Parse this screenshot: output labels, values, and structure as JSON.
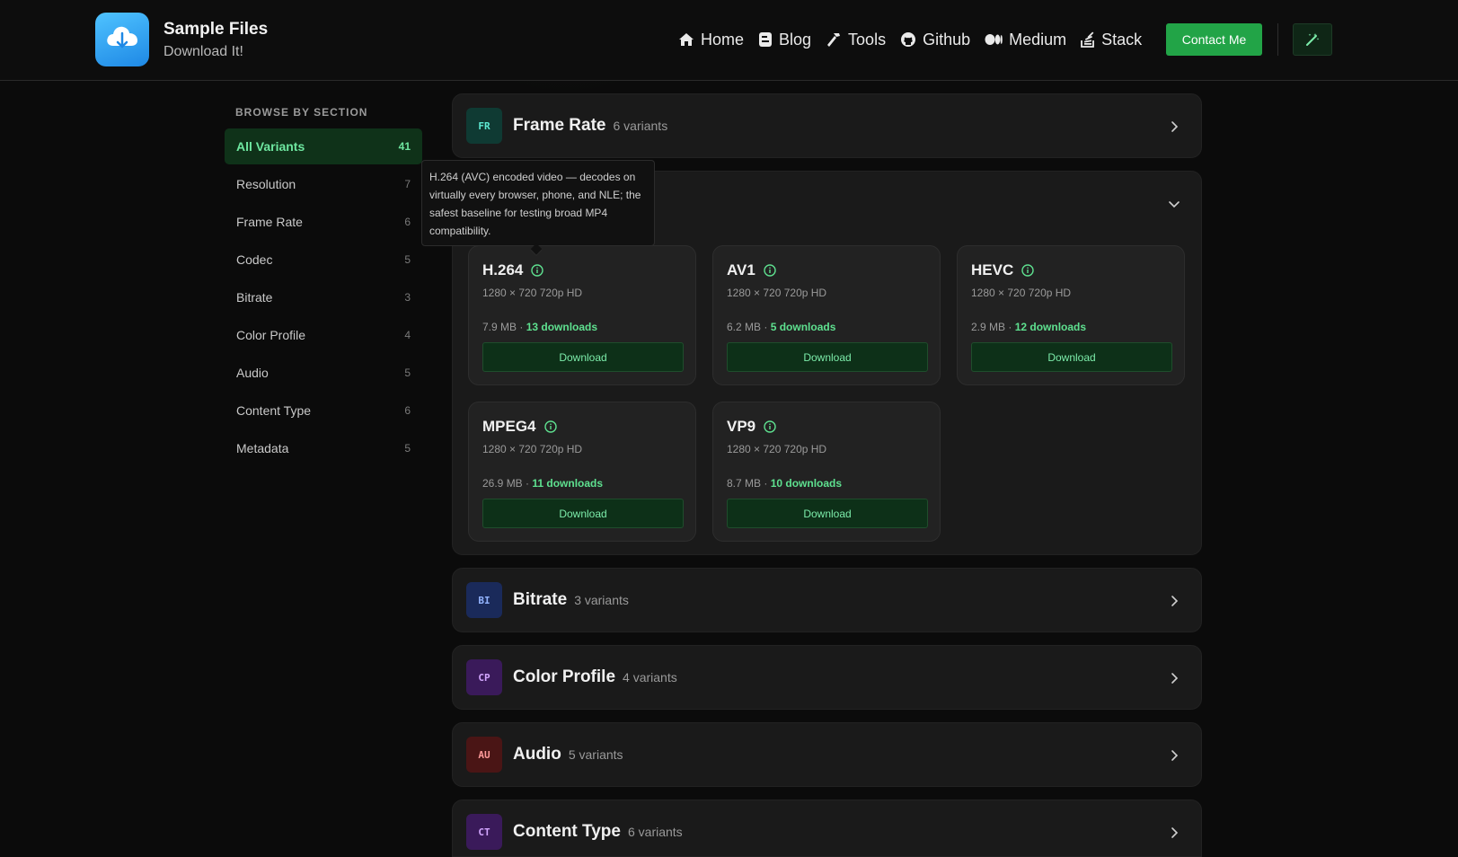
{
  "brand": {
    "title": "Sample Files",
    "subtitle": "Download It!"
  },
  "nav": [
    {
      "label": "Home",
      "icon": "home-icon"
    },
    {
      "label": "Blog",
      "icon": "blog-icon"
    },
    {
      "label": "Tools",
      "icon": "hammer-icon"
    },
    {
      "label": "Github",
      "icon": "github-icon"
    },
    {
      "label": "Medium",
      "icon": "medium-icon"
    },
    {
      "label": "Stack",
      "icon": "stack-overflow-icon"
    }
  ],
  "header": {
    "contact_label": "Contact Me",
    "theme_icon": "magic-wand-icon"
  },
  "sidebar": {
    "title": "BROWSE BY SECTION",
    "items": [
      {
        "label": "All Variants",
        "count": "41",
        "active": true
      },
      {
        "label": "Resolution",
        "count": "7"
      },
      {
        "label": "Frame Rate",
        "count": "6"
      },
      {
        "label": "Codec",
        "count": "5"
      },
      {
        "label": "Bitrate",
        "count": "3"
      },
      {
        "label": "Color Profile",
        "count": "4"
      },
      {
        "label": "Audio",
        "count": "5"
      },
      {
        "label": "Content Type",
        "count": "6"
      },
      {
        "label": "Metadata",
        "count": "5"
      }
    ]
  },
  "sections": {
    "frame_rate": {
      "badge": "FR",
      "title": "Frame Rate",
      "subtitle": "6 variants"
    },
    "bitrate": {
      "badge": "BI",
      "title": "Bitrate",
      "subtitle": "3 variants"
    },
    "color_profile": {
      "badge": "CP",
      "title": "Color Profile",
      "subtitle": "4 variants"
    },
    "audio": {
      "badge": "AU",
      "title": "Audio",
      "subtitle": "5 variants"
    },
    "content_type": {
      "badge": "CT",
      "title": "Content Type",
      "subtitle": "6 variants"
    }
  },
  "tooltip": {
    "text": "H.264 (AVC) encoded video — decodes on virtually every browser, phone, and NLE; the safest baseline for testing broad MP4 compatibility."
  },
  "codec_cards": [
    {
      "name": "H.264",
      "spec": "1280 × 720 720p HD",
      "size": "7.9 MB ·",
      "downloads": "13 downloads",
      "button": "Download"
    },
    {
      "name": "AV1",
      "spec": "1280 × 720 720p HD",
      "size": "6.2 MB ·",
      "downloads": "5 downloads",
      "button": "Download"
    },
    {
      "name": "HEVC",
      "spec": "1280 × 720 720p HD",
      "size": "2.9 MB ·",
      "downloads": "12 downloads",
      "button": "Download"
    },
    {
      "name": "MPEG4",
      "spec": "1280 × 720 720p HD",
      "size": "26.9 MB ·",
      "downloads": "11 downloads",
      "button": "Download"
    },
    {
      "name": "VP9",
      "spec": "1280 × 720 720p HD",
      "size": "8.7 MB ·",
      "downloads": "10 downloads",
      "button": "Download"
    }
  ],
  "colors": {
    "accent": "#22a447",
    "download_text": "#5ee08f",
    "badge_fr": "#0f3a33",
    "badge_bi": "#1a2a5a",
    "badge_cp": "#3a1a5a",
    "badge_au": "#4a1515",
    "badge_ct": "#3a1a5a"
  }
}
